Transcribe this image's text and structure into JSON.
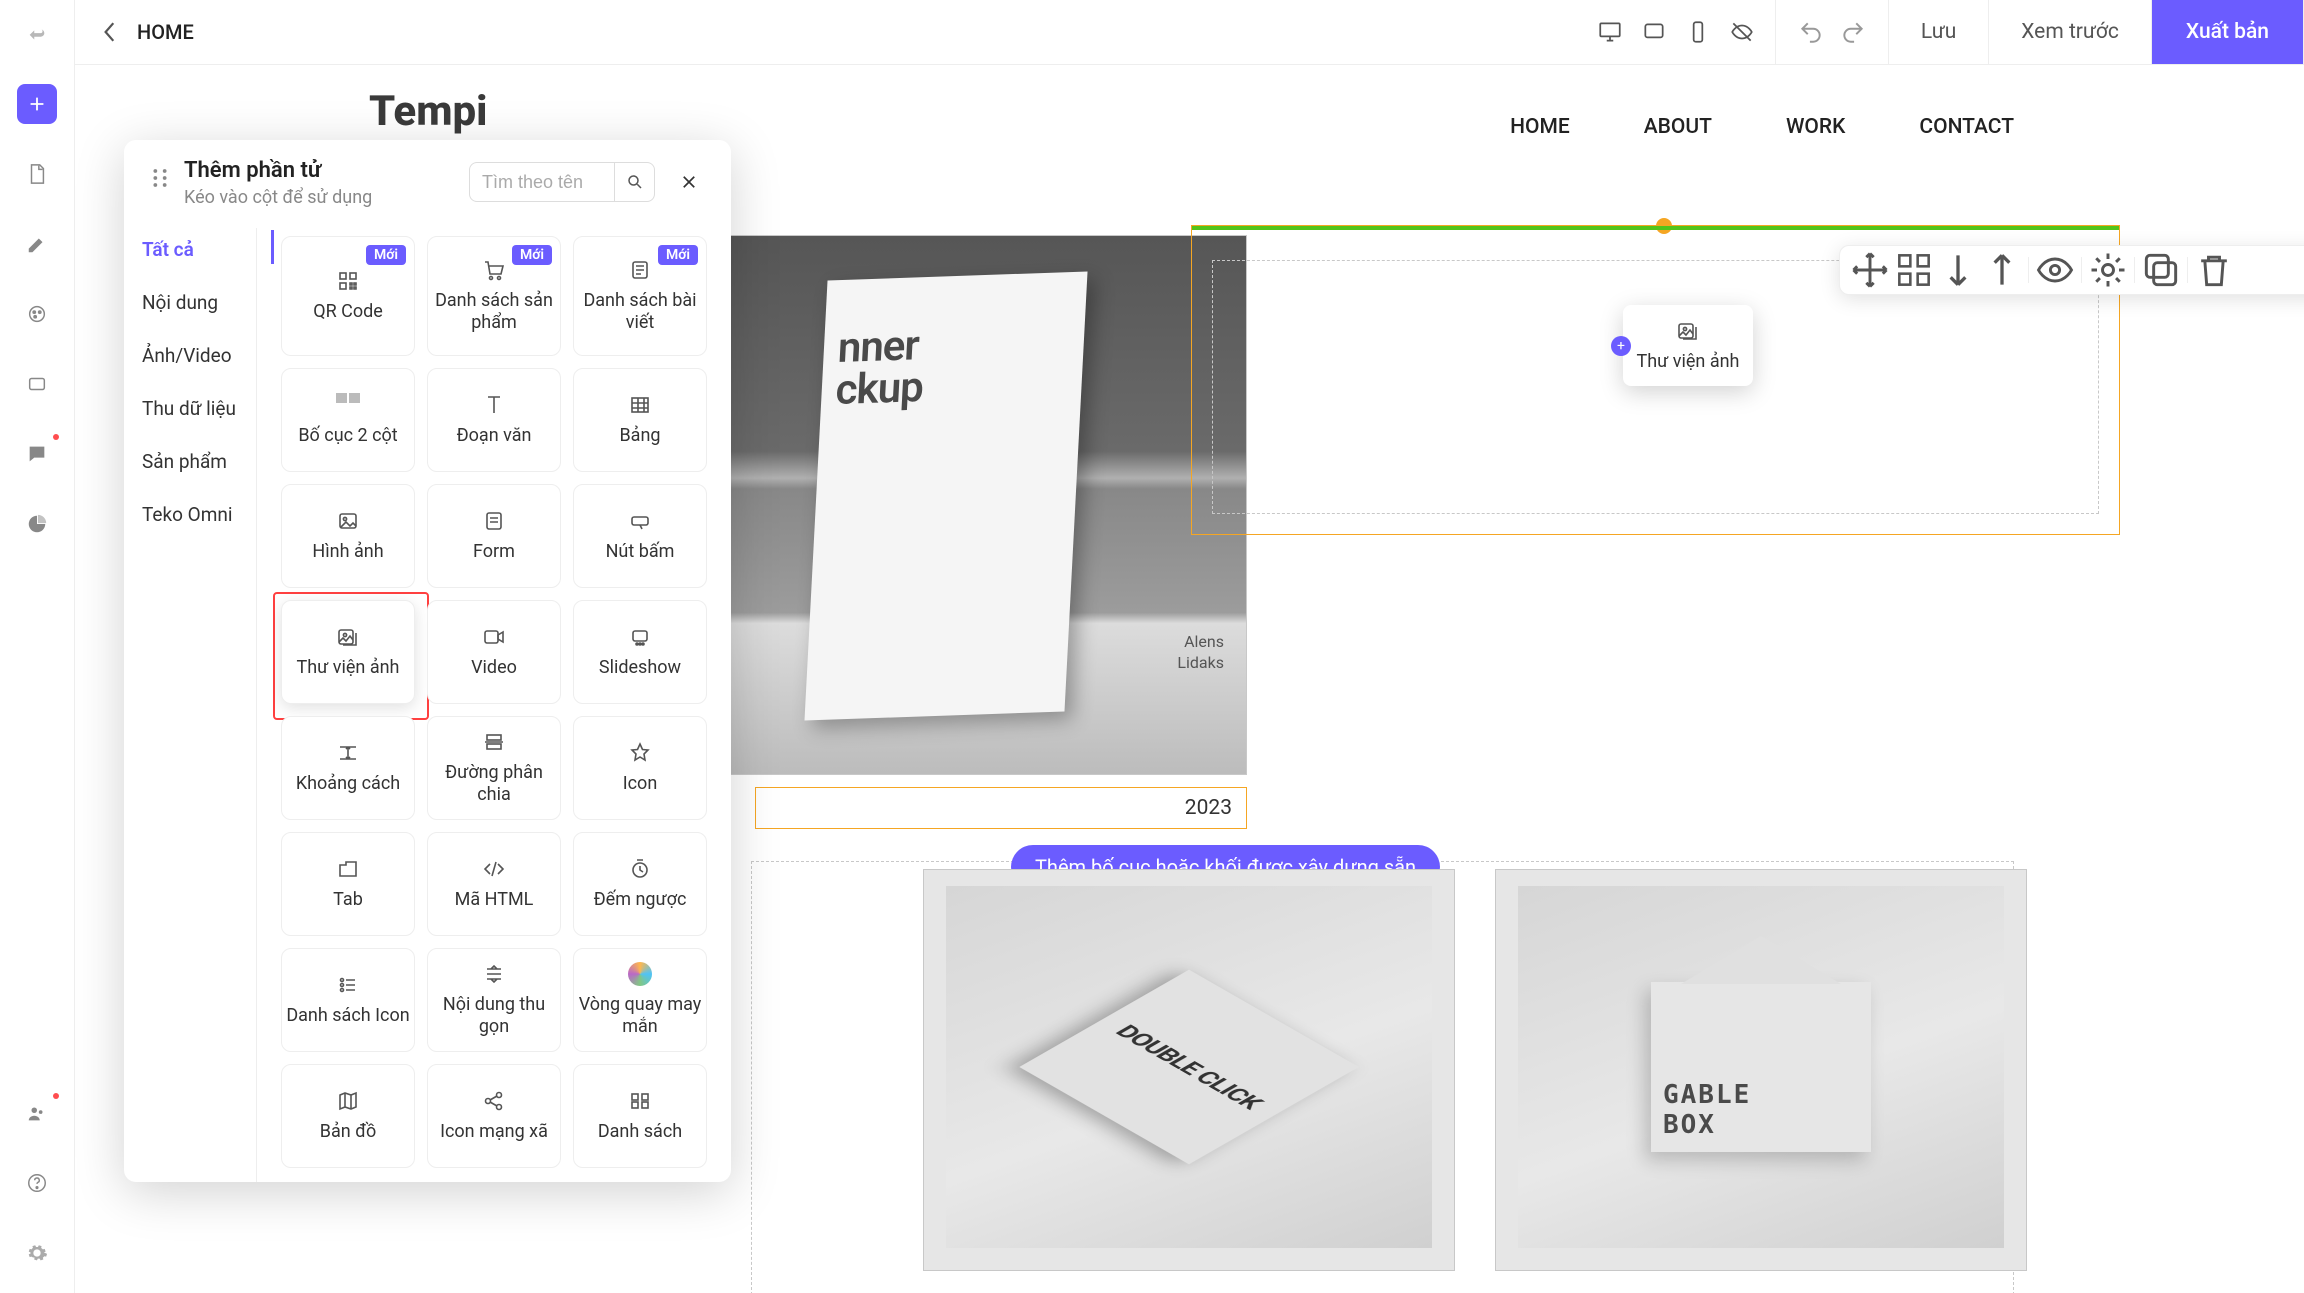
{
  "topbar": {
    "back": "‹",
    "title": "HOME",
    "save": "Lưu",
    "preview": "Xem trước",
    "publish": "Xuất bản"
  },
  "site": {
    "logo": "Tempi",
    "nav": [
      "HOME",
      "ABOUT",
      "WORK",
      "CONTACT"
    ]
  },
  "banner": {
    "l1": "nner",
    "l2": "ckup",
    "credit1": "Alens",
    "credit2": "Lidaks",
    "year": "2023"
  },
  "drag": {
    "label": "Thư viện ảnh"
  },
  "hint": "Thêm bố cục hoặc khối được xây dựng sẵn",
  "cards": {
    "c1": "DOUBLE CLICK",
    "gableA": "GABLE",
    "gableB": "BOX"
  },
  "panel": {
    "title": "Thêm phần tử",
    "sub": "Kéo vào cột để sử dụng",
    "searchPh": "Tìm theo tên",
    "cats": [
      "Tất cả",
      "Nội dung",
      "Ảnh/Video",
      "Thu dữ liệu",
      "Sản phẩm",
      "Teko Omni"
    ],
    "newBadge": "Mới",
    "tiles": {
      "r0": [
        "QR Code",
        "Danh sách sản phẩm",
        "Danh sách bài viết"
      ],
      "r1": [
        "Bố cục 2 cột",
        "Đoạn văn",
        "Bảng"
      ],
      "r2": [
        "Hình ảnh",
        "Form",
        "Nút bấm"
      ],
      "r3": [
        "Thư viện ảnh",
        "Video",
        "Slideshow"
      ],
      "r4": [
        "Khoảng cách",
        "Đường phân chia",
        "Icon"
      ],
      "r5": [
        "Tab",
        "Mã HTML",
        "Đếm ngược"
      ],
      "r6": [
        "Danh sách Icon",
        "Nội dung thu gọn",
        "Vòng quay may mắn"
      ],
      "r7": [
        "Bản đồ",
        "Icon mạng xã",
        "Danh sách"
      ]
    }
  }
}
